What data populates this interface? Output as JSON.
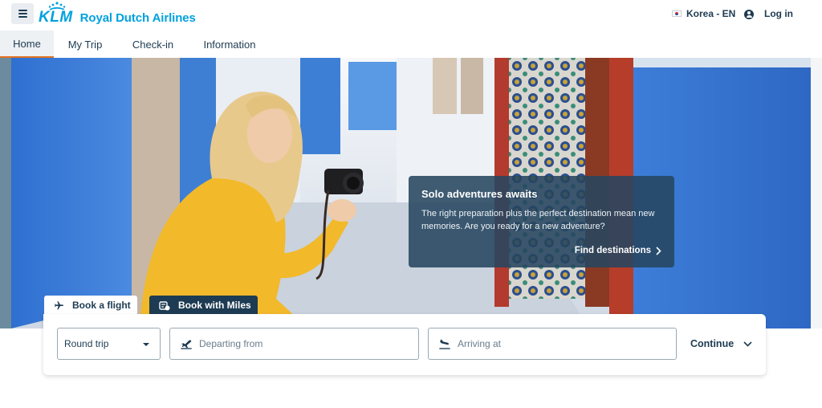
{
  "header": {
    "menu_icon": "hamburger-icon",
    "logo_mark": "KLM",
    "logo_text": "Royal Dutch Airlines",
    "locale_label": "Korea - EN",
    "login_label": "Log in"
  },
  "nav": {
    "tabs": [
      {
        "label": "Home",
        "active": true
      },
      {
        "label": "My Trip",
        "active": false
      },
      {
        "label": "Check-in",
        "active": false
      },
      {
        "label": "Information",
        "active": false
      }
    ]
  },
  "promo": {
    "title": "Solo adventures awaits",
    "text": "The right preparation plus the perfect destination mean new memories. Are you ready for a new adventure?",
    "link_label": "Find destinations"
  },
  "booking": {
    "tabs": [
      {
        "label": "Book a flight",
        "icon": "airplane-icon",
        "active": true
      },
      {
        "label": "Book with Miles",
        "icon": "miles-icon",
        "active": false
      }
    ],
    "trip_type": "Round trip",
    "departing_placeholder": "Departing from",
    "arriving_placeholder": "Arriving at",
    "continue_label": "Continue"
  },
  "colors": {
    "brand_blue": "#00a1de",
    "navy": "#1d3b52",
    "active_tab_underline": "#e37222",
    "promo_overlay": "#264660"
  }
}
